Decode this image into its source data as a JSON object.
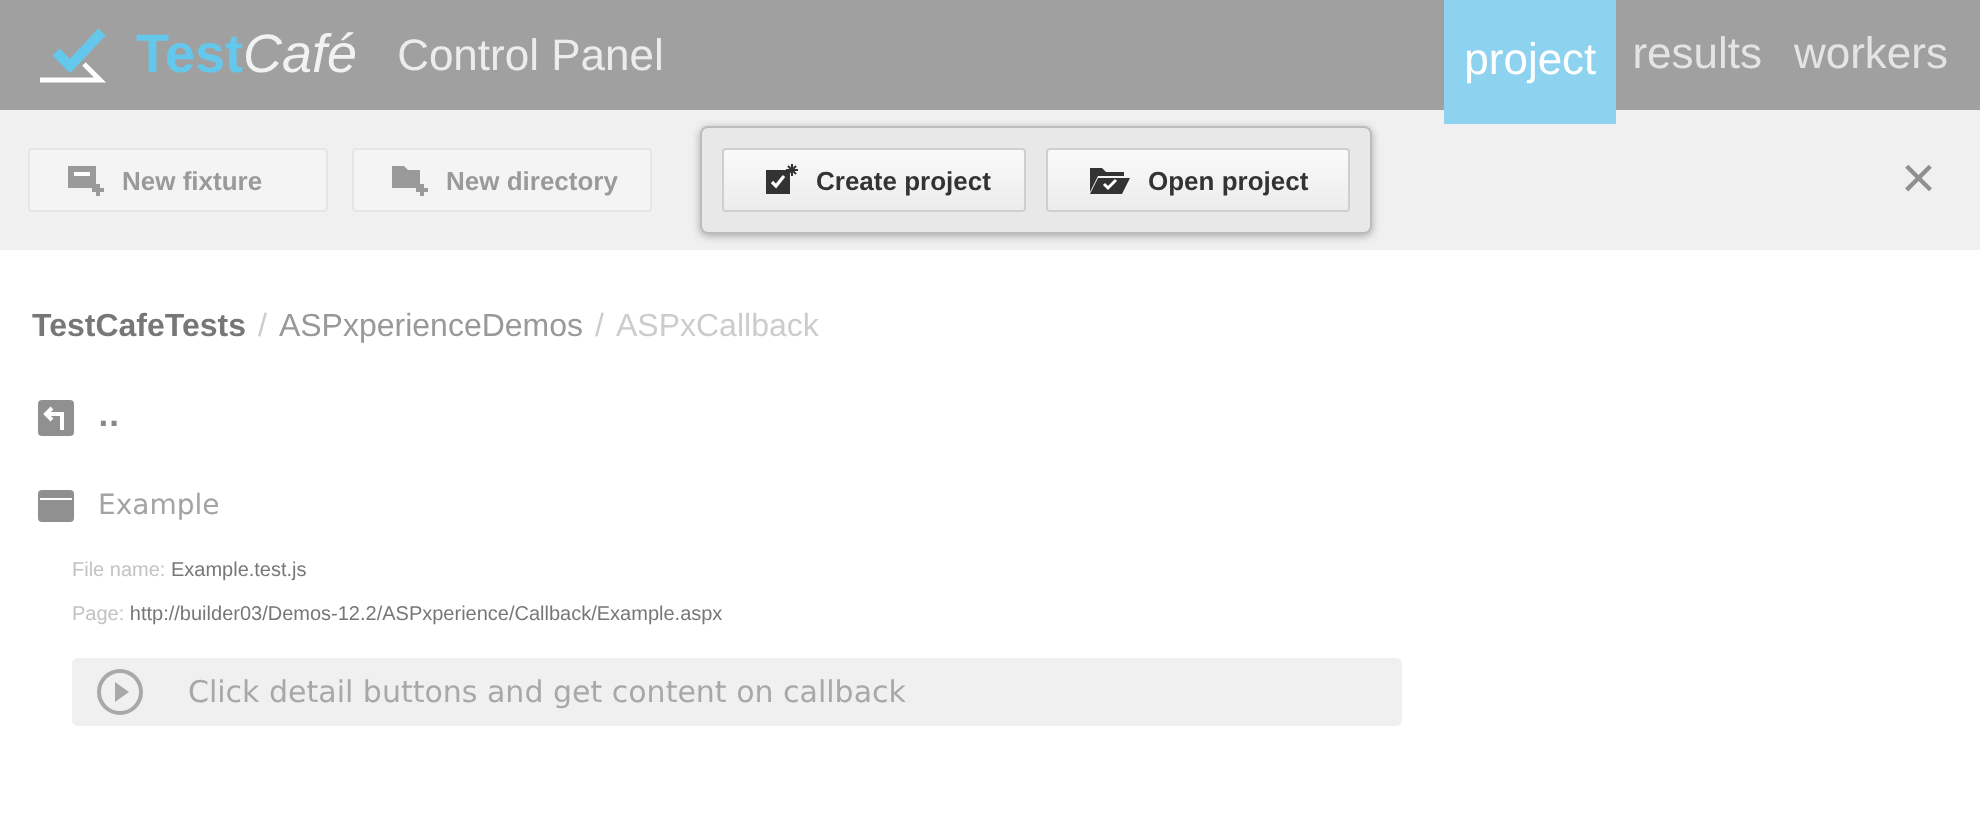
{
  "header": {
    "logo": {
      "brand_a": "Test",
      "brand_b": "Café"
    },
    "title": "Control Panel",
    "tabs": [
      {
        "label": "project",
        "selected": true
      },
      {
        "label": "results",
        "selected": false
      },
      {
        "label": "workers",
        "selected": false
      }
    ]
  },
  "toolbar": {
    "buttons": [
      {
        "label": "New fixture",
        "kind": "fixture",
        "highlighted": false
      },
      {
        "label": "New directory",
        "kind": "directory",
        "highlighted": false
      },
      {
        "label": "Create project",
        "kind": "create",
        "highlighted": true
      },
      {
        "label": "Open project",
        "kind": "open",
        "highlighted": true
      }
    ],
    "close": "×"
  },
  "breadcrumb": {
    "items": [
      {
        "label": "TestCafeTests",
        "kind": "root"
      },
      {
        "label": "ASPxperienceDemos",
        "kind": "folder"
      },
      {
        "label": "ASPxCallback",
        "kind": "current"
      }
    ],
    "separators": [
      "/",
      "/"
    ]
  },
  "entries": [
    {
      "kind": "up",
      "label": ".."
    },
    {
      "kind": "fixture",
      "label": "Example"
    }
  ],
  "fixture": {
    "file_label": "File name:",
    "file_value": "Example.test.js",
    "page_label": "Page:",
    "page_value": "http://builder03/Demos-12.2/ASPxperience/Callback/Example.aspx",
    "tests": [
      {
        "label": "Click detail buttons and get content on callback"
      }
    ]
  }
}
